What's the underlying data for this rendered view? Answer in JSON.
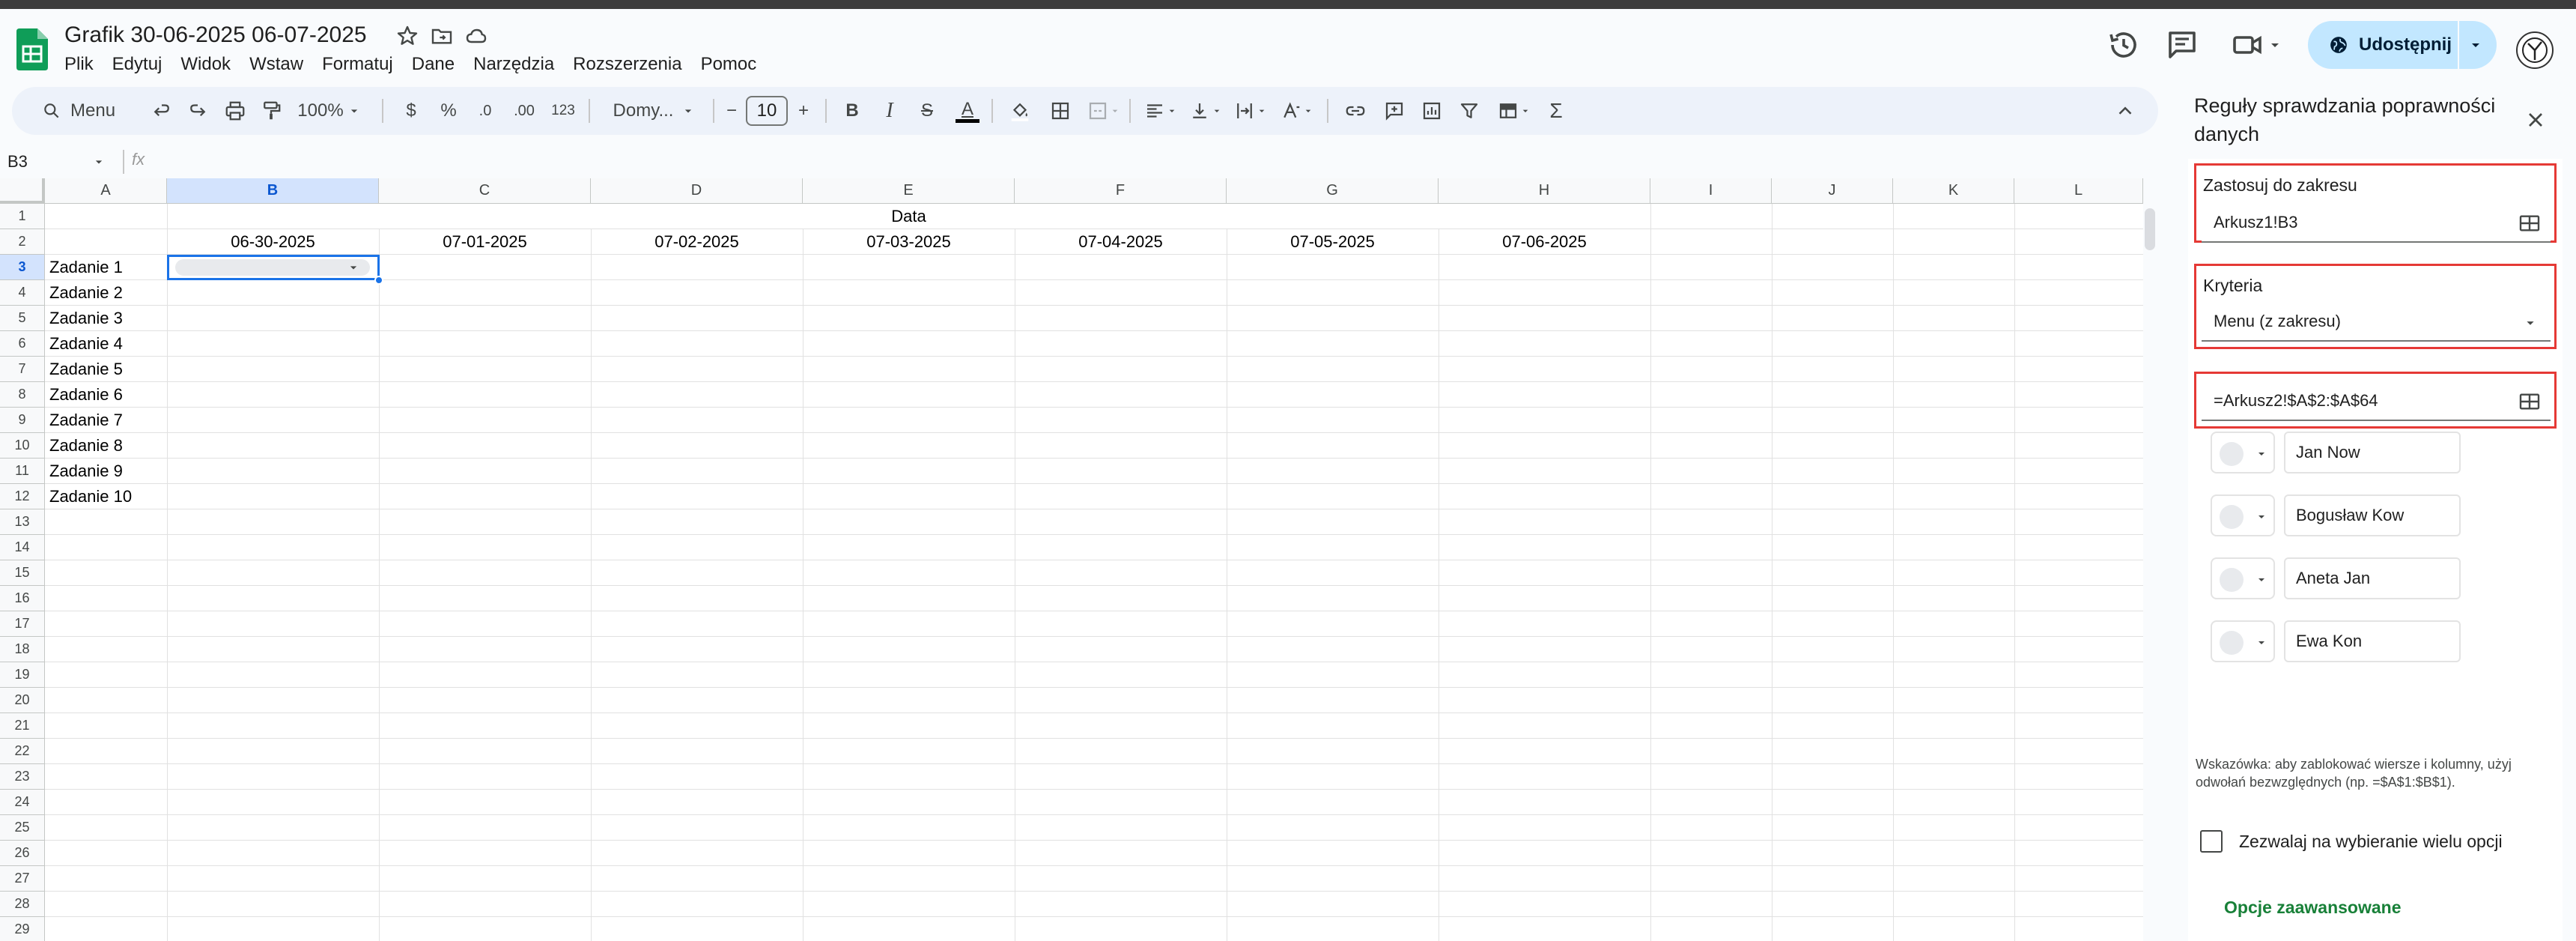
{
  "app": {
    "doc_title": "Grafik 30-06-2025  06-07-2025",
    "menu": [
      "Plik",
      "Edytuj",
      "Widok",
      "Wstaw",
      "Formatuj",
      "Dane",
      "Narzędzia",
      "Rozszerzenia",
      "Pomoc"
    ],
    "share_label": "Udostępnij"
  },
  "toolbar": {
    "search_label": "Menu",
    "zoom": "100%",
    "currency": "$",
    "percent": "%",
    "dec_decrease": ".0",
    "dec_increase": ".00",
    "number_format": "123",
    "font": "Domy...",
    "font_size": "10",
    "minus": "−",
    "plus": "+",
    "bold": "B",
    "italic": "I",
    "strike": "S",
    "text_color": "A",
    "sigma": "Σ"
  },
  "formula_bar": {
    "name_box": "B3",
    "fx": "fx"
  },
  "sheet": {
    "columns": [
      "A",
      "B",
      "C",
      "D",
      "E",
      "F",
      "G",
      "H",
      "I",
      "J",
      "K",
      "L"
    ],
    "rows": [
      "1",
      "2",
      "3",
      "4",
      "5",
      "6",
      "7",
      "8",
      "9",
      "10",
      "11",
      "12",
      "13",
      "14",
      "15",
      "16",
      "17",
      "18",
      "19",
      "20",
      "21",
      "22",
      "23",
      "24",
      "25",
      "26",
      "27",
      "28",
      "29"
    ],
    "merged_header": "Data",
    "dates": [
      "06-30-2025",
      "07-01-2025",
      "07-02-2025",
      "07-03-2025",
      "07-04-2025",
      "07-05-2025",
      "07-06-2025"
    ],
    "tasks": [
      "Zadanie 1",
      "Zadanie 2",
      "Zadanie 3",
      "Zadanie 4",
      "Zadanie 5",
      "Zadanie 6",
      "Zadanie 7",
      "Zadanie 8",
      "Zadanie 9",
      "Zadanie 10"
    ]
  },
  "panel": {
    "title": "Reguły sprawdzania poprawności danych",
    "range_label": "Zastosuj do zakresu",
    "range_value": "Arkusz1!B3",
    "criteria_label": "Kryteria",
    "criteria_value": "Menu (z zakresu)",
    "source_range": "=Arkusz2!$A$2:$A$64",
    "options": [
      "Jan Now",
      "Bogusław Kow",
      "Aneta Jan",
      "Ewa Kon"
    ],
    "hint": "Wskazówka: aby zablokować wiersze i kolumny, użyj odwołań bezwzględnych (np. =$A$1:$B$1).",
    "multi_select_label": "Zezwalaj na wybieranie wielu opcji",
    "advanced_label": "Opcje zaawansowane"
  }
}
